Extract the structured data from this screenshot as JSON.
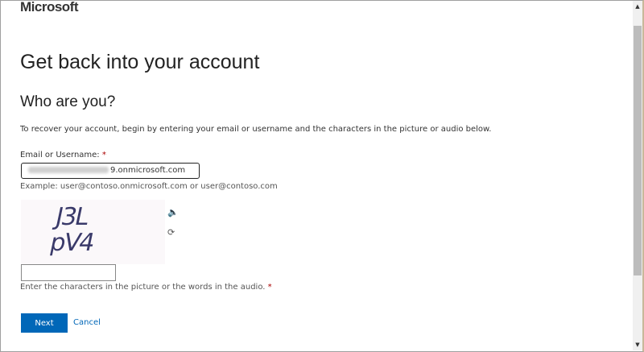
{
  "brand": "Microsoft",
  "title": "Get back into your account",
  "subtitle": "Who are you?",
  "intro": "To recover your account, begin by entering your email or username and the characters in the picture or audio below.",
  "email": {
    "label": "Email or Username: ",
    "required": "*",
    "value_visible_suffix": "9.onmicrosoft.com",
    "example": "Example: user@contoso.onmicrosoft.com or user@contoso.com"
  },
  "captcha": {
    "text": "J3L pV4",
    "audio_icon": "speaker-icon",
    "refresh_icon": "refresh-icon",
    "input_value": "",
    "hint": "Enter the characters in the picture or the words in the audio. ",
    "required": "*"
  },
  "buttons": {
    "next": "Next",
    "cancel": "Cancel"
  },
  "colors": {
    "accent": "#0067b8",
    "required": "#aa0000"
  }
}
